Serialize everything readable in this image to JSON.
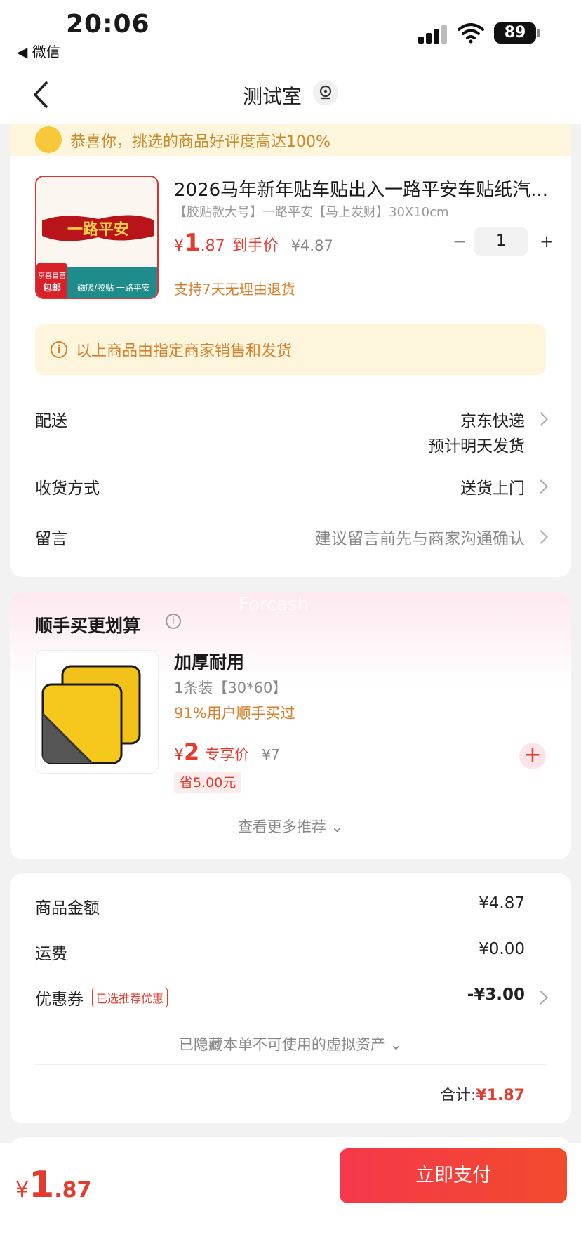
{
  "status_bar": {
    "time": "20:06",
    "back_app": "◀ 微信",
    "battery": "89"
  },
  "nav": {
    "title": "测试室"
  },
  "banner": {
    "text": "恭喜你，挑选的商品好评度高达100%"
  },
  "product": {
    "title": "2026马年新年贴车贴出入一路平安车贴纸汽...",
    "spec": "【胶贴款大号】一路平安【马上发财】30X10cm",
    "currency": "¥",
    "price_int": "1",
    "price_dec": ".87",
    "price_label": "到手价",
    "orig_price": "¥4.87",
    "quantity": "1",
    "return_tip": "支持7天无理由退货",
    "img_badge": "京喜自营\n包邮",
    "img_caption": "磁吸/胶贴 一路平安",
    "img_text": "一路平安"
  },
  "notice": {
    "text": "以上商品由指定商家销售和发货"
  },
  "rows": {
    "delivery_label": "配送",
    "delivery_value": "京东快递",
    "delivery_eta": "预计明天发货",
    "receive_label": "收货方式",
    "receive_value": "送货上门",
    "message_label": "留言",
    "message_value": "建议留言前先与商家沟通确认"
  },
  "addon": {
    "section_title": "顺手买更划算",
    "title": "加厚耐用",
    "spec": "1条装【30*60】",
    "bought": "91%用户顺手买过",
    "currency": "¥",
    "price": "2",
    "price_label": "专享价",
    "orig_price": "¥7",
    "save": "省5.00元",
    "more": "查看更多推荐 ⌄",
    "watermark": "Forcash"
  },
  "summary": {
    "goods_label": "商品金额",
    "goods_value": "¥4.87",
    "shipping_label": "运费",
    "shipping_value": "¥0.00",
    "coupon_label": "优惠券",
    "coupon_tag": "已选推荐优惠",
    "coupon_value": "-¥3.00",
    "hidden_assets": "已隐藏本单不可使用的虚拟资产 ⌄",
    "total_label": "合计:",
    "total_value": "¥1.87"
  },
  "bottom": {
    "currency": "¥",
    "price_int": "1",
    "price_dec": ".87",
    "pay_label": "立即支付"
  },
  "colors": {
    "accent": "#e43b2f",
    "tip": "#d7802d",
    "banner_bg": "#fdf6dc"
  }
}
